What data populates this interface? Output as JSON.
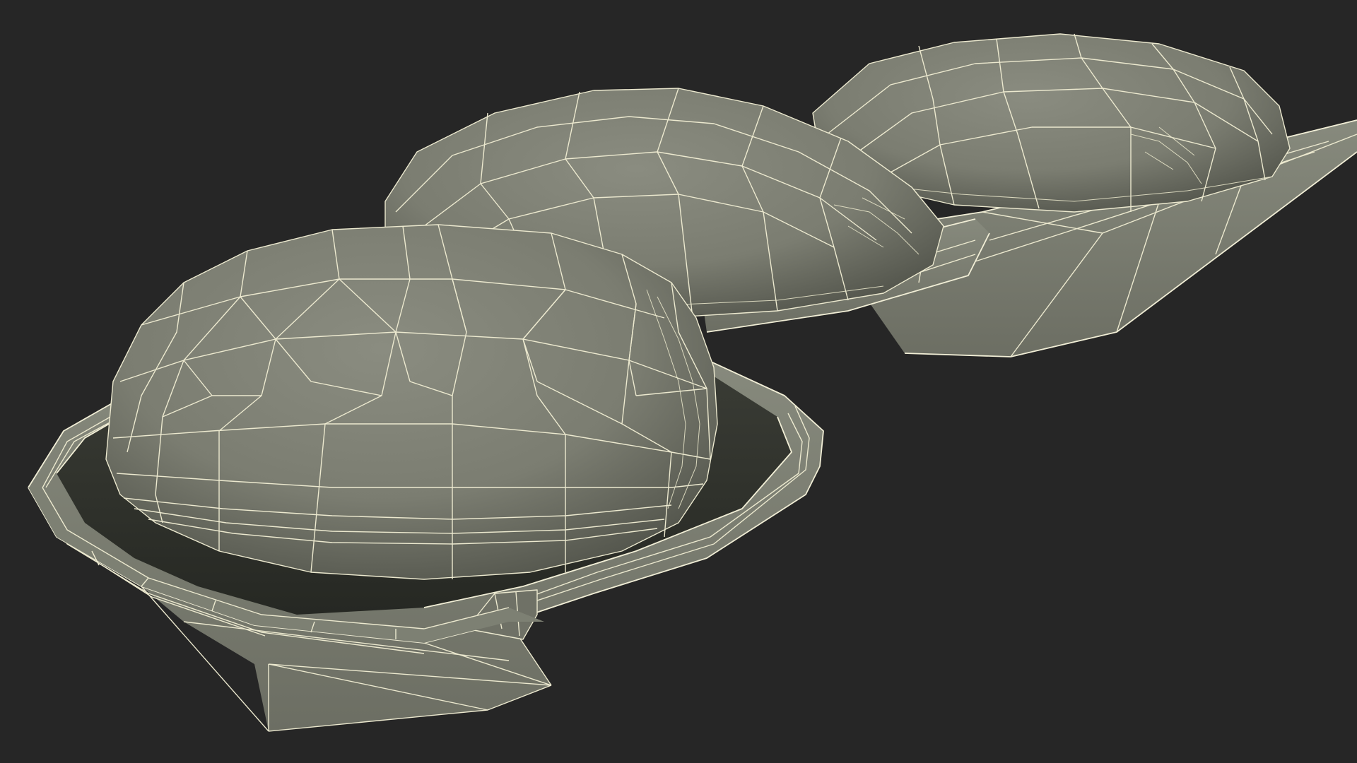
{
  "scene": {
    "background_color": "#262626",
    "mesh_color": "#7f8175",
    "wire_color": "#ece9cf",
    "shadow_color": "#2d2f2a",
    "object": "peanut-shell-3d-wireframe",
    "peanut_count": 3
  }
}
